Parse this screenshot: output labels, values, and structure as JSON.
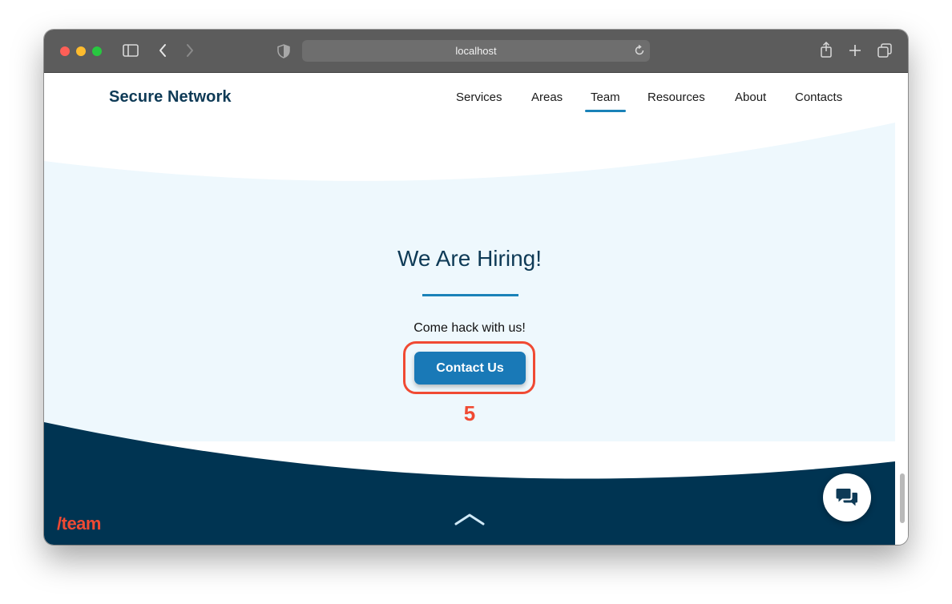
{
  "browser": {
    "url": "localhost"
  },
  "nav": {
    "brand": "Secure Network",
    "items": [
      {
        "label": "Services"
      },
      {
        "label": "Areas"
      },
      {
        "label": "Team",
        "active": true
      },
      {
        "label": "Resources"
      },
      {
        "label": "About"
      },
      {
        "label": "Contacts"
      }
    ]
  },
  "hero": {
    "title": "We Are Hiring!",
    "subtitle": "Come hack with us!",
    "cta_label": "Contact Us"
  },
  "annotation": {
    "marker": "5"
  },
  "footer": {
    "path_label": "/team"
  },
  "icons": {
    "sidebar": "sidebar-toggle-icon",
    "back": "chevron-left-icon",
    "forward": "chevron-right-icon",
    "shield": "shield-icon",
    "reload": "reload-icon",
    "share": "share-icon",
    "new_tab": "plus-icon",
    "tabs": "tabs-overview-icon",
    "scroll_top": "chevron-up-icon",
    "chat": "chat-bubbles-icon"
  },
  "colors": {
    "brand_navy": "#0e3a56",
    "accent_blue": "#1979b7",
    "hero_bg": "#eef8fd",
    "footer_bg": "#003452",
    "annotation_red": "#f04a33"
  }
}
